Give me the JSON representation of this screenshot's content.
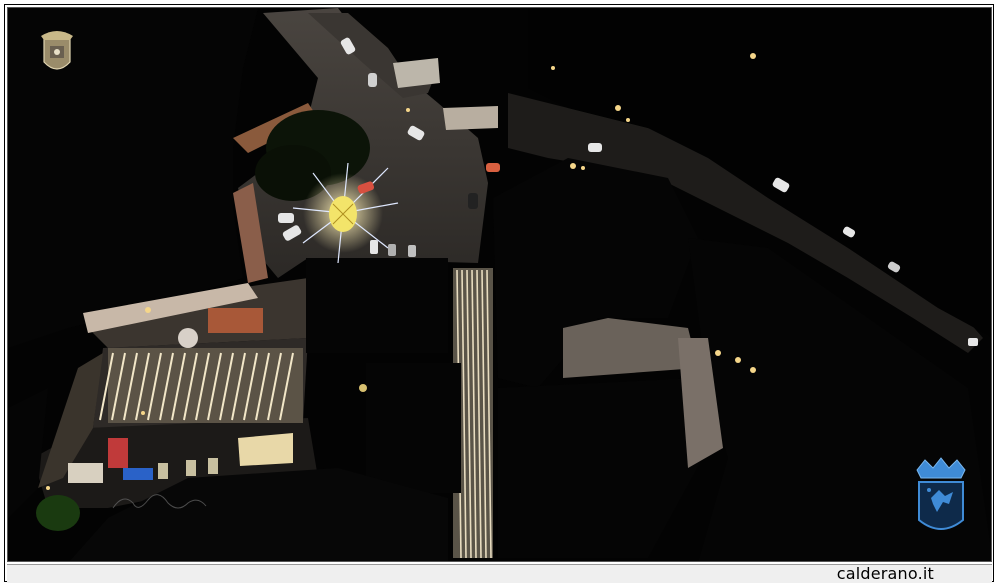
{
  "photo": {
    "subject": "aerial-night-town-square",
    "icons": {
      "top_left": "town-crest-icon",
      "bottom_right": "coat-of-arms-icon"
    }
  },
  "caption": {
    "text": "calderano.it"
  },
  "colors": {
    "background": "#030303",
    "street_light": "#f5d68a",
    "crest_blue": "#3f8bd6"
  }
}
